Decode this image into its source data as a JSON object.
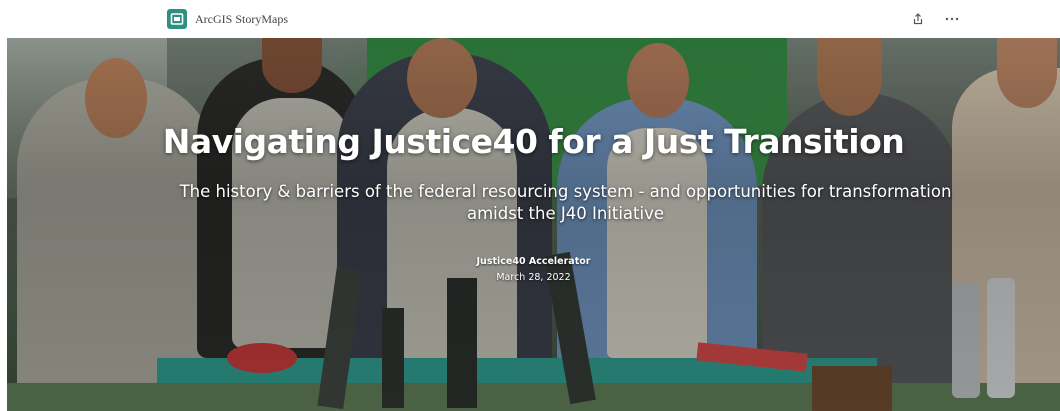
{
  "header": {
    "brand_name": "ArcGIS StoryMaps",
    "logo_icon": "storymaps-logo-icon",
    "share_icon": "share-icon",
    "more_icon": "more-options-icon",
    "accent": "#2f8f83"
  },
  "hero": {
    "title": "Navigating Justice40 for a Just Transition",
    "subtitle": "The history & barriers of the federal resourcing system - and opportunities for transformation amidst the J40 Initiative",
    "author": "Justice40 Accelerator",
    "date": "March 28, 2022",
    "image_description_colors": {
      "banner_green": "#3a8746",
      "shirt_gray": "#b7b6ad",
      "table_teal": "#2f9a8d"
    }
  }
}
